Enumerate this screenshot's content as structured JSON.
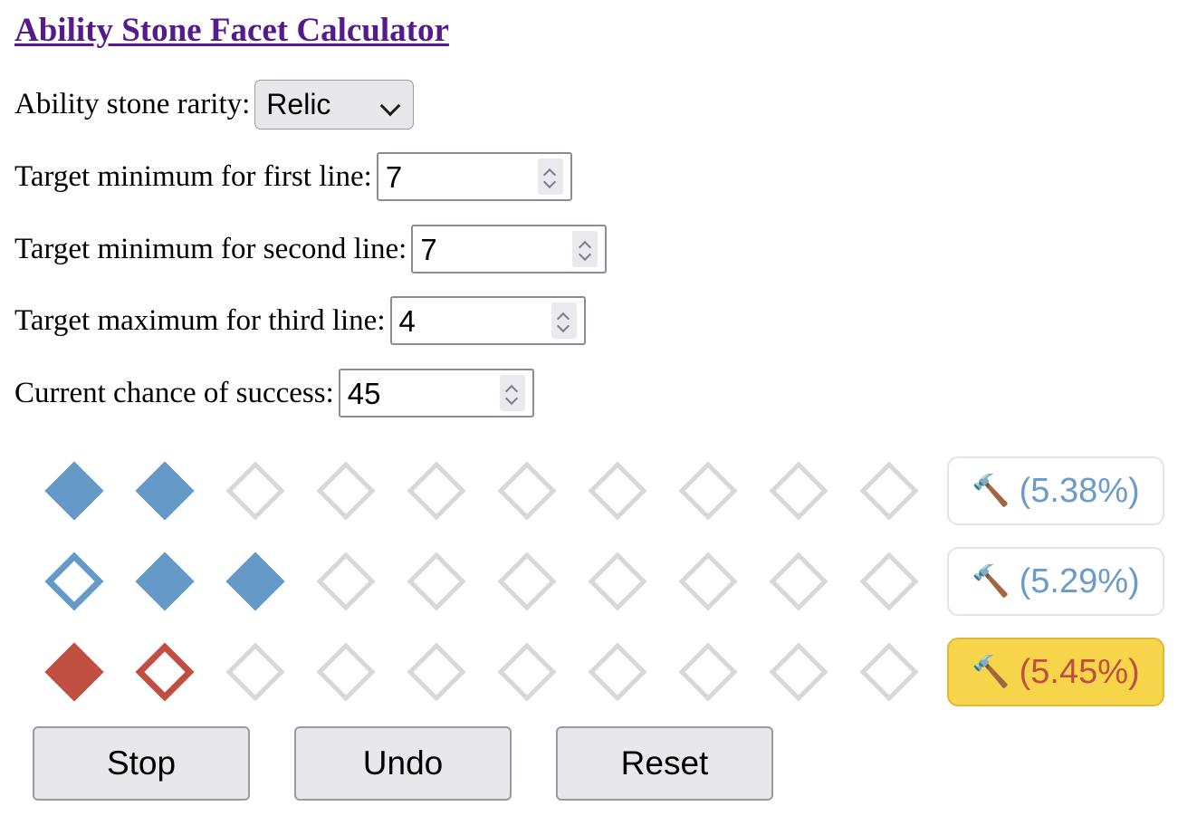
{
  "title": "Ability Stone Facet Calculator",
  "form": {
    "rarity": {
      "label": "Ability stone rarity:",
      "value": "Relic",
      "options": [
        "Relic"
      ]
    },
    "first_line": {
      "label": "Target minimum for first line:",
      "value": "7"
    },
    "second_line": {
      "label": "Target minimum for second line:",
      "value": "7"
    },
    "third_line": {
      "label": "Target maximum for third line:",
      "value": "4"
    },
    "chance": {
      "label": "Current chance of success:",
      "value": "45"
    }
  },
  "facets": {
    "columns": 10,
    "rows": [
      {
        "name": "first-line",
        "cells": [
          "blue-filled",
          "blue-filled",
          "empty",
          "empty",
          "empty",
          "empty",
          "empty",
          "empty",
          "empty",
          "empty"
        ],
        "badge": {
          "icon": "hammer-icon",
          "icon_glyph": "🔨",
          "text": "(5.38%)",
          "text_color": "#6b9bc9",
          "highlighted": false
        }
      },
      {
        "name": "second-line",
        "cells": [
          "blue-hollow",
          "blue-filled",
          "blue-filled",
          "empty",
          "empty",
          "empty",
          "empty",
          "empty",
          "empty",
          "empty"
        ],
        "badge": {
          "icon": "hammer-icon",
          "icon_glyph": "🔨",
          "text": "(5.29%)",
          "text_color": "#6b9bc9",
          "highlighted": false
        }
      },
      {
        "name": "third-line",
        "cells": [
          "red-filled",
          "red-hollow",
          "empty",
          "empty",
          "empty",
          "empty",
          "empty",
          "empty",
          "empty",
          "empty"
        ],
        "badge": {
          "icon": "hammer-icon",
          "icon_glyph": "🔨",
          "text": "(5.45%)",
          "text_color": "#c04f42",
          "highlighted": true
        }
      }
    ]
  },
  "buttons": [
    {
      "name": "stop-button",
      "label": "Stop"
    },
    {
      "name": "undo-button",
      "label": "Undo"
    },
    {
      "name": "reset-button",
      "label": "Reset"
    }
  ],
  "colors": {
    "title": "#551a8b",
    "blue": "#659ac8",
    "red": "#c04f42",
    "empty": "#d8d8d8",
    "highlight_bg": "#f7d54a",
    "highlight_border": "#ddb93a"
  }
}
